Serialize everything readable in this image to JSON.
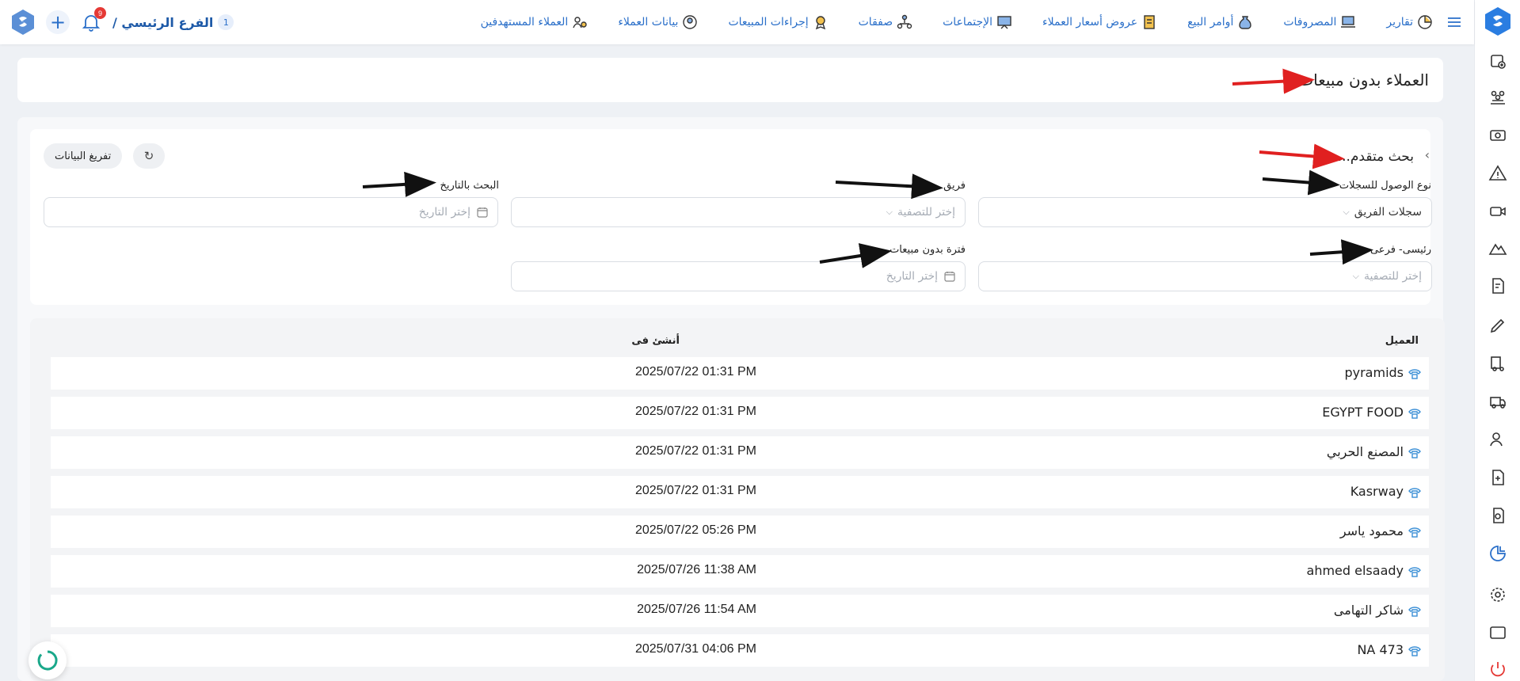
{
  "header": {
    "nav": [
      {
        "label": "العملاء المستهدفين",
        "icon": "target-users-icon"
      },
      {
        "label": "بيانات العملاء",
        "icon": "customer-data-icon"
      },
      {
        "label": "إجراءات المبيعات",
        "icon": "sales-actions-icon"
      },
      {
        "label": "صفقات",
        "icon": "deals-icon"
      },
      {
        "label": "الإجتماعات",
        "icon": "meetings-icon"
      },
      {
        "label": "عروض أسعار العملاء",
        "icon": "quotations-icon"
      },
      {
        "label": "أوامر البيع",
        "icon": "sales-orders-icon"
      },
      {
        "label": "المصروفات",
        "icon": "expenses-icon"
      },
      {
        "label": "تقارير",
        "icon": "reports-icon"
      }
    ],
    "branch_label": "الفرع الرئيسي /",
    "branch_count": "1",
    "notification_count": "9"
  },
  "page": {
    "title": "العملاء بدون مبيعات"
  },
  "filters": {
    "title": "بحث متقدم...",
    "clear_label": "تفريغ البيانات",
    "access_type": {
      "label": "نوع الوصول للسجلات",
      "value": "سجلات الفريق"
    },
    "team": {
      "label": "فريق",
      "placeholder": "إختر للتصفية"
    },
    "date_search": {
      "label": "البحث بالتاريخ",
      "placeholder": "إختر التاريخ"
    },
    "main_sub": {
      "label": "رئيسى- فرعى",
      "placeholder": "إختر للتصفية"
    },
    "no_sales_period": {
      "label": "فترة بدون مبيعات",
      "placeholder": "إختر التاريخ"
    }
  },
  "table": {
    "columns": {
      "customer": "العميل",
      "created_at": "أنشئ فى"
    },
    "rows": [
      {
        "customer": "pyramids",
        "created_at": "2025/07/22 01:31 PM"
      },
      {
        "customer": "EGYPT FOOD",
        "created_at": "2025/07/22 01:31 PM"
      },
      {
        "customer": "المصنع الحربي",
        "created_at": "2025/07/22 01:31 PM"
      },
      {
        "customer": "Kasrway",
        "created_at": "2025/07/22 01:31 PM"
      },
      {
        "customer": "محمود ياسر",
        "created_at": "2025/07/22 05:26 PM"
      },
      {
        "customer": "ahmed elsaady",
        "created_at": "2025/07/26 11:38 AM"
      },
      {
        "customer": "شاكر التهامى",
        "created_at": "2025/07/26 11:54 AM"
      },
      {
        "customer": "NA 473",
        "created_at": "2025/07/31 04:06 PM"
      }
    ]
  },
  "colors": {
    "accent": "#2a6fc9",
    "red_arrow": "#e02020",
    "black_arrow": "#111111"
  }
}
